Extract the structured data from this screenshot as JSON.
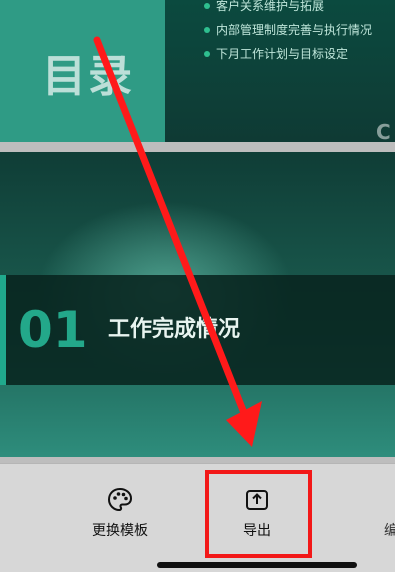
{
  "slide1": {
    "title": "目录",
    "items": [
      "客户关系维护与拓展",
      "内部管理制度完善与执行情况",
      "下月工作计划与目标设定"
    ],
    "corner": "C"
  },
  "slide2": {
    "number": "01",
    "section_title": "工作完成情况"
  },
  "toolbar": {
    "template_label": "更换模板",
    "export_label": "导出",
    "partial_label": "编"
  },
  "colors": {
    "accent_teal": "#16876f",
    "highlight_red": "#f21818",
    "arrow_red": "#ff1a1a"
  }
}
